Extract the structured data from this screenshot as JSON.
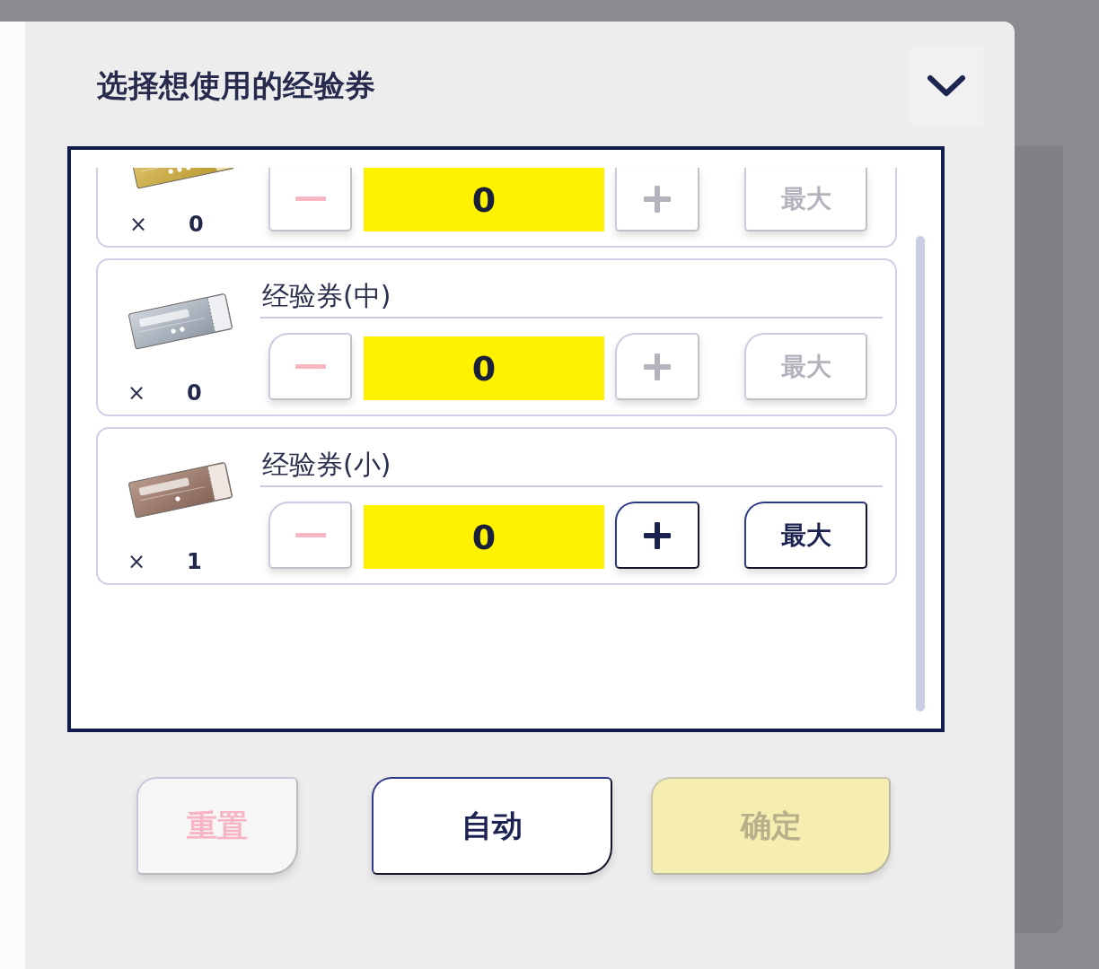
{
  "dialog": {
    "title": "选择想使用的经验券"
  },
  "tickets": [
    {
      "kind": "gold",
      "owned_sign": "×",
      "owned": "0",
      "count": "0",
      "minus_disabled": true,
      "plus_disabled": true,
      "max_label": "最大",
      "max_disabled": true
    },
    {
      "kind": "silver",
      "name": "经验券(中)",
      "owned_sign": "×",
      "owned": "0",
      "count": "0",
      "minus_disabled": true,
      "plus_disabled": true,
      "max_label": "最大",
      "max_disabled": true
    },
    {
      "kind": "bronze",
      "name": "经验券(小)",
      "owned_sign": "×",
      "owned": "1",
      "count": "0",
      "minus_disabled": true,
      "plus_disabled": false,
      "max_label": "最大",
      "max_disabled": false
    }
  ],
  "actions": [
    {
      "kind": "reset",
      "label": "重置",
      "disabled": true
    },
    {
      "kind": "auto",
      "label": "自动",
      "disabled": false
    },
    {
      "kind": "confirm",
      "label": "确定",
      "disabled": true
    }
  ]
}
